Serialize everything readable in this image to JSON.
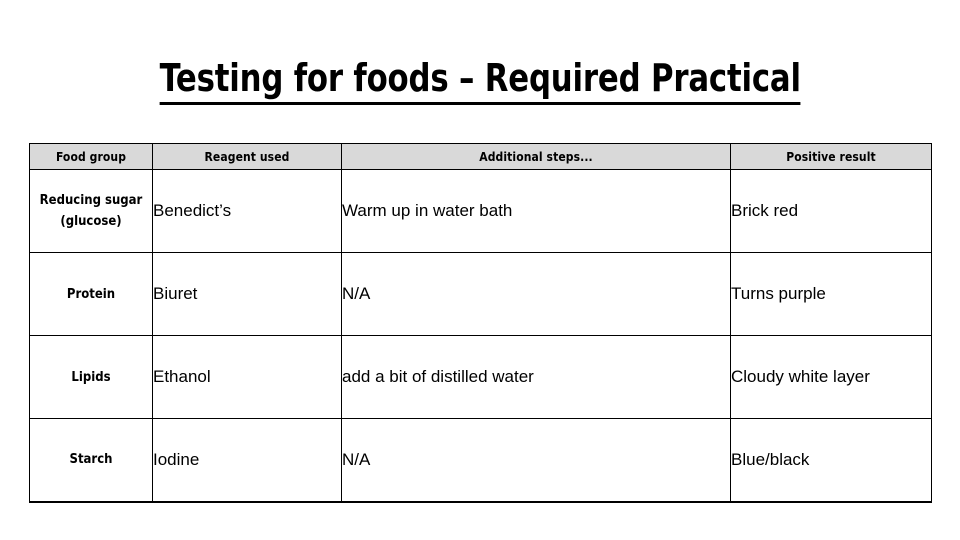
{
  "slide": {
    "title": "Testing for foods – Required Practical"
  },
  "table": {
    "headers": [
      "Food group",
      "Reagent used",
      "Additional steps...",
      "Positive result"
    ],
    "rows": [
      {
        "food_group": "Reducing sugar (glucose)",
        "reagent": "Benedict’s",
        "steps": "Warm up in water bath",
        "result": "Brick red"
      },
      {
        "food_group": "Protein",
        "reagent": "Biuret",
        "steps": "N/A",
        "result": "Turns purple"
      },
      {
        "food_group": "Lipids",
        "reagent": "Ethanol",
        "steps": "add a bit of distilled water",
        "result": "Cloudy white layer"
      },
      {
        "food_group": "Starch",
        "reagent": "Iodine",
        "steps": "N/A",
        "result": "Blue/black"
      }
    ]
  },
  "colors": {
    "header_background": "#d9d9d9",
    "border": "#000000",
    "text": "#000000",
    "page_background": "#ffffff"
  }
}
